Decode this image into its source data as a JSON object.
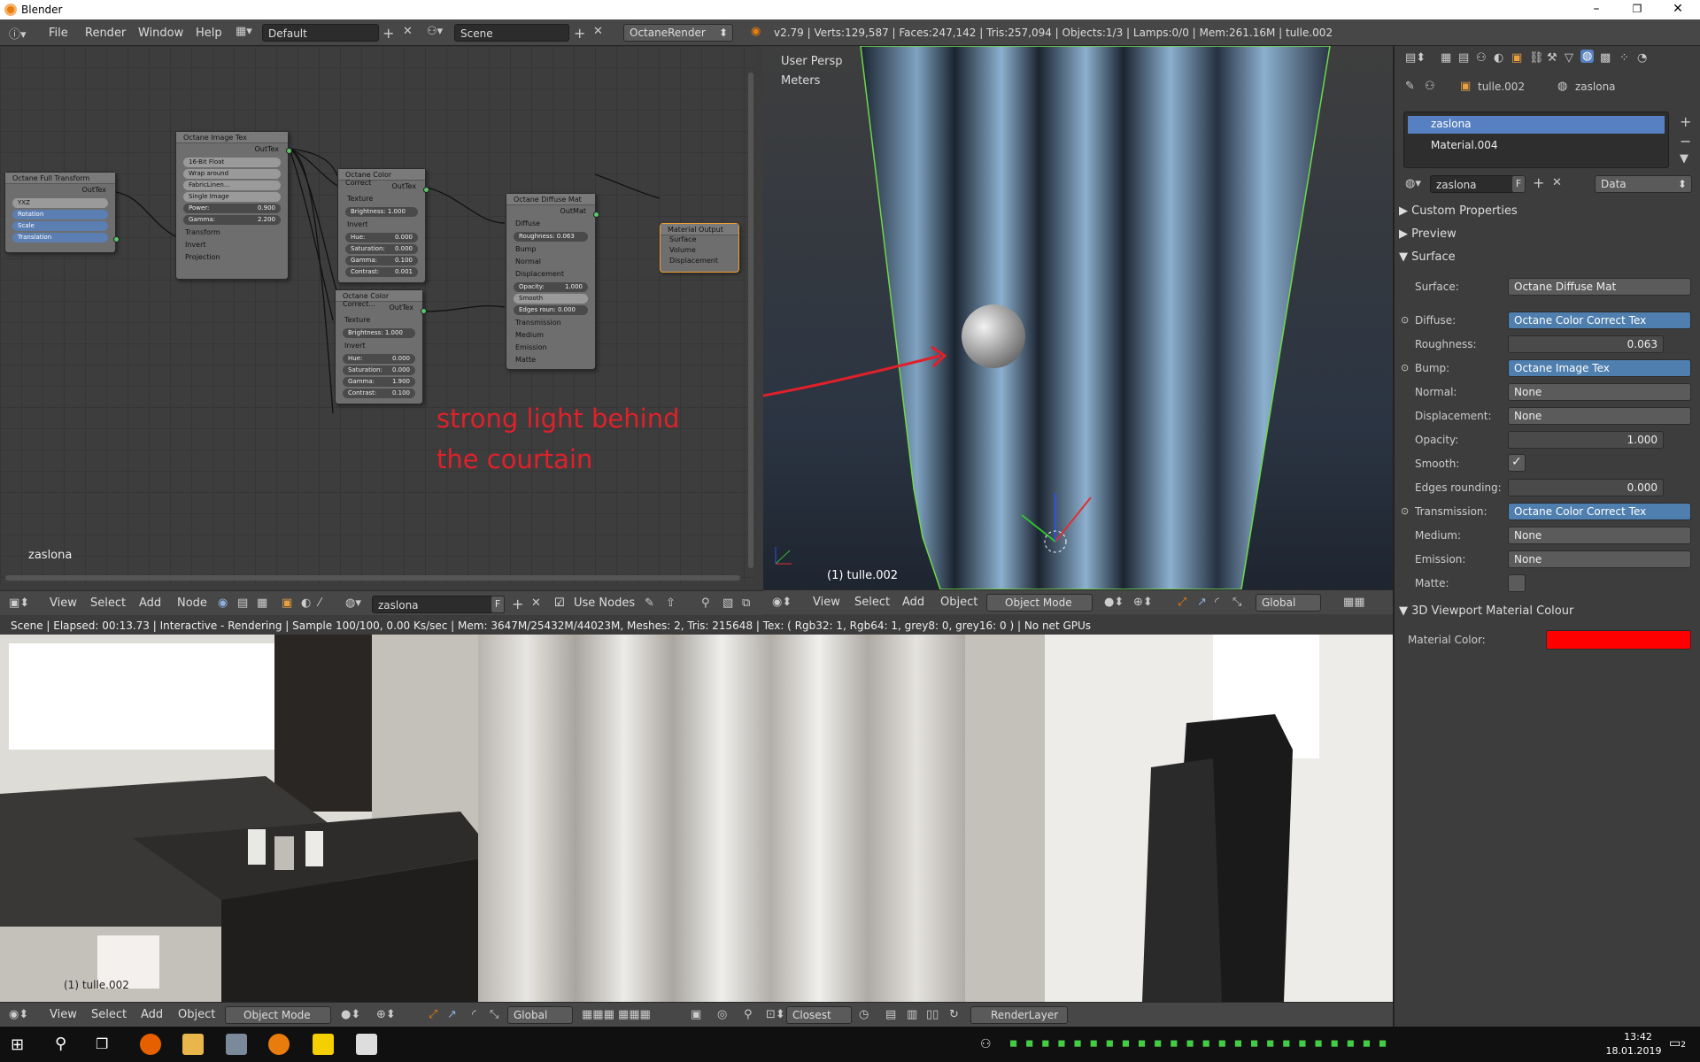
{
  "window": {
    "title": "Blender"
  },
  "info_header": {
    "menus": [
      "File",
      "Render",
      "Window",
      "Help"
    ],
    "screen_layout": "Default",
    "scene": "Scene",
    "render_engine": "OctaneRender",
    "stats": "v2.79 | Verts:129,587 | Faces:247,142 | Tris:257,094 | Objects:1/3 | Lamps:0/0 | Mem:261.16M | tulle.002"
  },
  "node_editor": {
    "material_label": "zaslona",
    "nodes": {
      "full_transform": {
        "title": "Octane Full Transform",
        "out": "OutTex",
        "rotation_order": "YXZ",
        "slots": [
          "Rotation",
          "Scale",
          "Translation"
        ]
      },
      "image_tex": {
        "title": "Octane Image Tex",
        "out": "OutTex",
        "type": "16-Bit Float",
        "wrap": "Wrap around",
        "file": "FabricLinen...",
        "mode": "Single Image",
        "power_label": "Power:",
        "power": "0.900",
        "gamma_label": "Gamma:",
        "gamma": "2.200",
        "inputs": [
          "Transform",
          "Invert",
          "Projection"
        ]
      },
      "color_correct_1": {
        "title": "Octane Color Correct",
        "out": "OutTex",
        "inputs": [
          "Texture"
        ],
        "brightness": "Brightness: 1.000",
        "invert": "Invert",
        "hue": "Hue:",
        "hue_v": "0.000",
        "saturation": "Saturation:",
        "saturation_v": "0.000",
        "gamma": "Gamma:",
        "gamma_v": "0.100",
        "contrast": "Contrast:",
        "contrast_v": "0.001"
      },
      "color_correct_2": {
        "title": "Octane Color Correct...",
        "out": "OutTex",
        "inputs": [
          "Texture"
        ],
        "brightness": "Brightness: 1.000",
        "invert": "Invert",
        "hue": "Hue:",
        "hue_v": "0.000",
        "saturation": "Saturation:",
        "saturation_v": "0.000",
        "gamma": "Gamma:",
        "gamma_v": "1.900",
        "contrast": "Contrast:",
        "contrast_v": "0.100"
      },
      "diffuse_mat": {
        "title": "Octane Diffuse Mat",
        "out": "OutMat",
        "diffuse": "Diffuse",
        "roughness": "Roughness: 0.063",
        "bump": "Bump",
        "normal": "Normal",
        "displacement": "Displacement",
        "opacity": "Opacity:",
        "opacity_v": "1.000",
        "smooth": "Smooth",
        "edges": "Edges roun: 0.000",
        "transmission": "Transmission",
        "medium": "Medium",
        "emission": "Emission",
        "matte": "Matte"
      },
      "material_output": {
        "title": "Material Output",
        "inputs": [
          "Surface",
          "Volume",
          "Displacement"
        ]
      }
    },
    "annotation_line1": "strong light behind",
    "annotation_line2": "the courtain",
    "header": {
      "menus": [
        "View",
        "Select",
        "Add",
        "Node"
      ],
      "material": "zaslona",
      "fake_user": "F",
      "use_nodes": "Use Nodes"
    }
  },
  "viewport3d": {
    "view_name": "User Persp",
    "units": "Meters",
    "object_label": "(1) tulle.002",
    "header": {
      "menus": [
        "View",
        "Select",
        "Add",
        "Object"
      ],
      "mode": "Object Mode",
      "orientation": "Global"
    }
  },
  "status_line": "Scene | Elapsed: 00:13.73 | Interactive - Rendering | Sample 100/100, 0.00 Ks/sec | Mem: 3647M/25432M/44023M, Meshes: 2, Tris: 215648 | Tex: ( Rgb32: 1, Rgb64: 1, grey8: 0, grey16: 0 ) | No net GPUs",
  "render_view": {
    "object_label": "(1) tulle.002",
    "header": {
      "menus": [
        "View",
        "Select",
        "Add",
        "Object"
      ],
      "mode": "Object Mode",
      "orientation": "Global",
      "snap": "Closest",
      "render_layer": "RenderLayer"
    }
  },
  "properties": {
    "breadcrumb_object": "tulle.002",
    "breadcrumb_material": "zaslona",
    "slots": [
      "zaslona",
      "Material.004"
    ],
    "material_name": "zaslona",
    "fake_user": "F",
    "link": "Data",
    "panels": {
      "custom_properties": "Custom Properties",
      "preview": "Preview",
      "surface": "Surface",
      "viewport_colour": "3D Viewport Material Colour"
    },
    "rows": [
      {
        "label": "Surface:",
        "value": "Octane Diffuse Mat"
      },
      {
        "label": "Diffuse:",
        "value": "Octane Color Correct Tex"
      },
      {
        "label": "Roughness:",
        "value": "0.063"
      },
      {
        "label": "Bump:",
        "value": "Octane Image Tex"
      },
      {
        "label": "Normal:",
        "value": "None"
      },
      {
        "label": "Displacement:",
        "value": "None"
      },
      {
        "label": "Opacity:",
        "value": "1.000"
      },
      {
        "label": "Smooth:",
        "value": ""
      },
      {
        "label": "Edges rounding:",
        "value": "0.000"
      },
      {
        "label": "Transmission:",
        "value": "Octane Color Correct Tex"
      },
      {
        "label": "Medium:",
        "value": "None"
      },
      {
        "label": "Emission:",
        "value": "None"
      },
      {
        "label": "Matte:",
        "value": ""
      }
    ],
    "material_color_label": "Material Color:",
    "material_color": "#ff0000"
  },
  "taskbar": {
    "time": "13:42",
    "date": "18.01.2019",
    "notifications": "2"
  },
  "colors": {
    "accent_blue": "#5680c2",
    "annotation_red": "#e0202a"
  }
}
